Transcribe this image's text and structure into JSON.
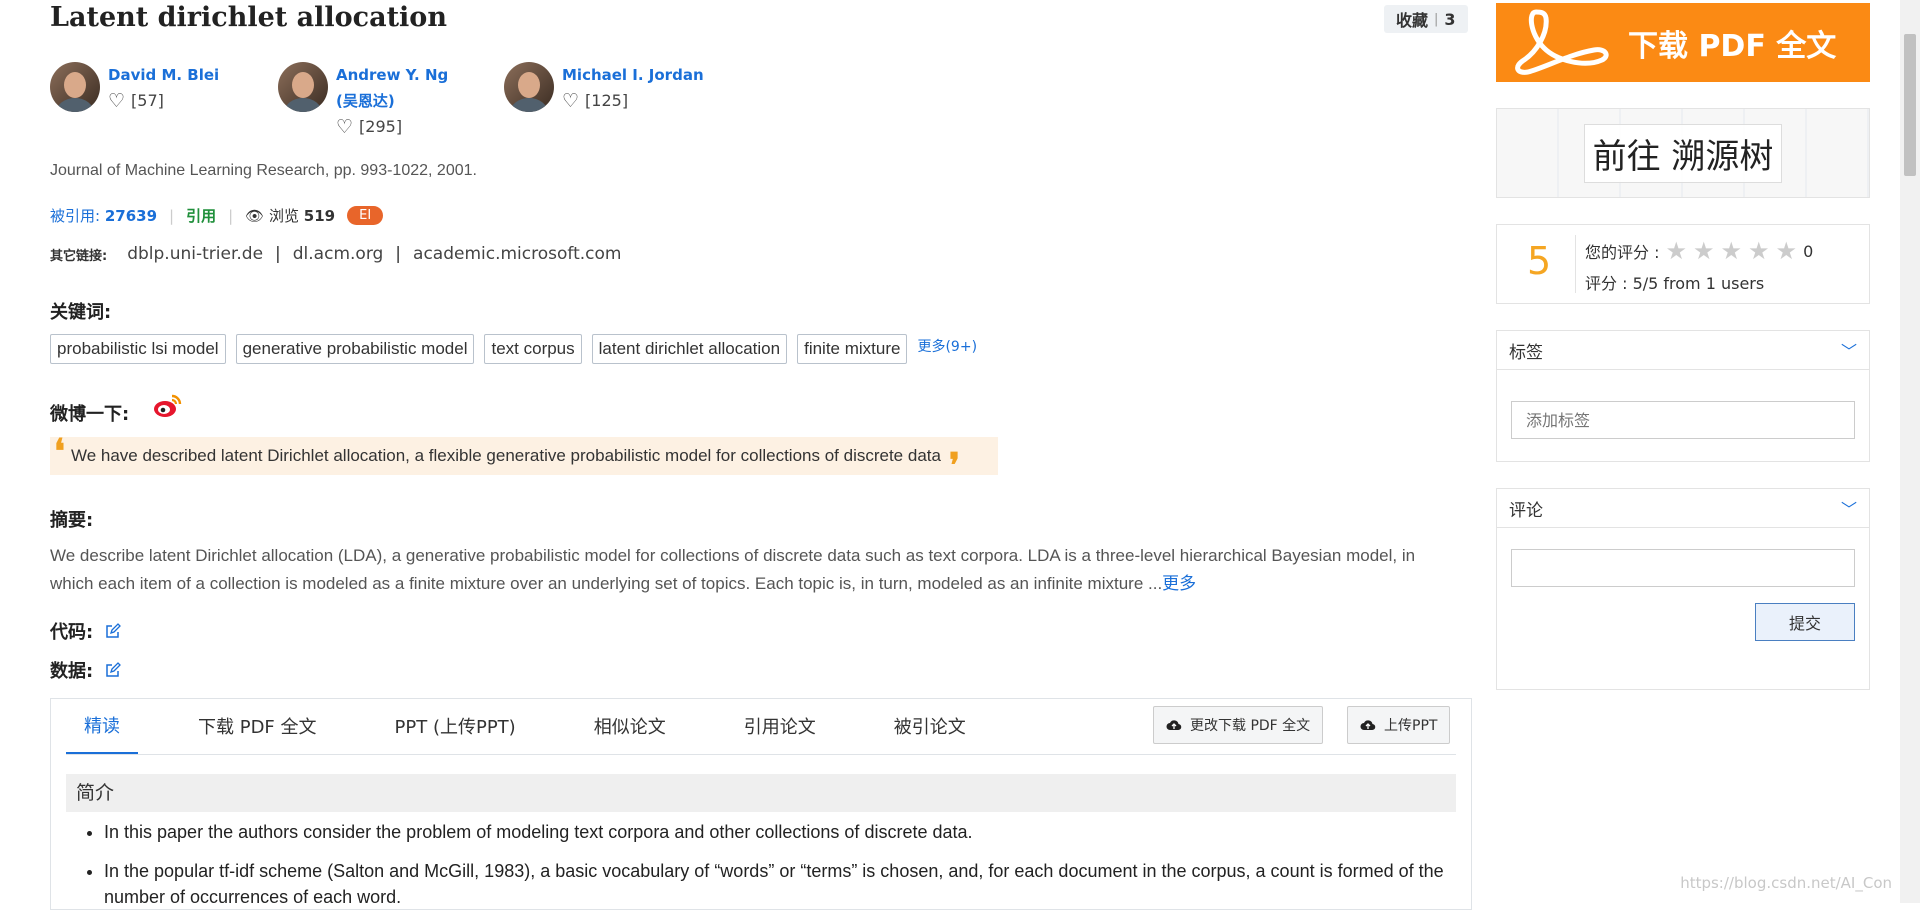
{
  "paper": {
    "title": "Latent dirichlet allocation",
    "favorite_label": "收藏",
    "favorite_count": "3",
    "journal": "Journal of Machine Learning Research, pp. 993-1022, 2001."
  },
  "authors": [
    {
      "name": "David M. Blei",
      "name2": "",
      "likes": "[57]"
    },
    {
      "name": "Andrew Y. Ng",
      "name2": "(吴恩达)",
      "likes": "[295]"
    },
    {
      "name": "Michael I. Jordan",
      "name2": "",
      "likes": "[125]"
    }
  ],
  "stats": {
    "cited_label": "被引用:",
    "cited_count": "27639",
    "cite_label": "引用",
    "views_label": "浏览",
    "views_count": "519",
    "badge": "EI"
  },
  "links": {
    "label": "其它链接:",
    "items": [
      "dblp.uni-trier.de",
      "dl.acm.org",
      "academic.microsoft.com"
    ]
  },
  "keywords": {
    "heading": "关键词:",
    "items": [
      "probabilistic lsi model",
      "generative probabilistic model",
      "text corpus",
      "latent dirichlet allocation",
      "finite mixture"
    ],
    "more": "更多(9+)"
  },
  "weibo": {
    "heading": "微博一下:",
    "quote": "We have described latent Dirichlet allocation, a flexible generative probabilistic model for collections of discrete data"
  },
  "abstract": {
    "heading": "摘要:",
    "text": "We describe latent Dirichlet allocation (LDA), a generative probabilistic model for collections of discrete data such as text corpora. LDA is a three-level hierarchical Bayesian model, in which each item of a collection is modeled as a finite mixture over an underlying set of topics. Each topic is, in turn, modeled as an infinite mixture ...",
    "more": "更多"
  },
  "code_label": "代码:",
  "data_label": "数据:",
  "tabs": [
    "精读",
    "下载 PDF 全文",
    "PPT (上传PPT)",
    "相似论文",
    "引用论文",
    "被引论文"
  ],
  "tab_buttons": {
    "change_pdf": "更改下载 PDF 全文",
    "upload_ppt": "上传PPT"
  },
  "intro": {
    "heading": "简介",
    "bullets": [
      "In this paper the authors consider the problem of modeling text corpora and other collections of discrete data.",
      "In the popular tf-idf scheme (Salton and McGill, 1983), a basic vocabulary of “words” or “terms” is chosen, and, for each document in the corpus, a count is formed of the number of occurrences of each word."
    ]
  },
  "sidebar": {
    "download_pdf": "下载 PDF 全文",
    "trace_tree": "前往 溯源树",
    "rating_value": "5",
    "your_rating_label": "您的评分 :",
    "your_rating_count": "0",
    "rating_summary": "评分 : 5/5 from 1 users",
    "tags_title": "标签",
    "tags_placeholder": "添加标签",
    "comments_title": "评论",
    "submit": "提交"
  },
  "watermark": "https://blog.csdn.net/AI_Con",
  "colors": {
    "accent": "#1a6fd8",
    "orange": "#fb8a14",
    "green": "#1f8f3a",
    "quote_bg": "#fdf1e3"
  }
}
